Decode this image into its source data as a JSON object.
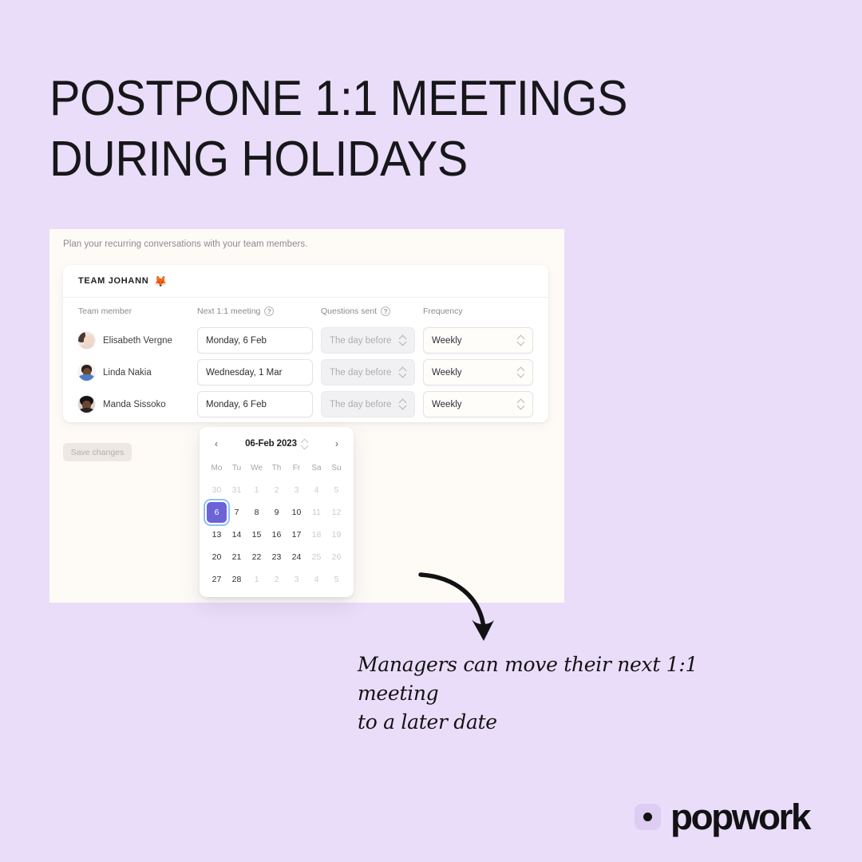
{
  "theme": {
    "page_bg": "#EADDFA",
    "panel_bg": "#FEFBF7",
    "accent_purple": "#6C63D8",
    "focus_ring": "#8DC3F0",
    "text_dark": "#17171A"
  },
  "headline": {
    "line1": "Postpone 1:1 meetings",
    "line2": "during holidays"
  },
  "panel": {
    "subtitle": "Plan your recurring conversations with your team members.",
    "team": {
      "name": "Team Johann",
      "emoji": "🦊"
    },
    "columns": {
      "member": "Team member",
      "next_meeting": "Next 1:1 meeting",
      "questions_sent": "Questions sent",
      "frequency": "Frequency",
      "help_glyph": "?"
    },
    "rows": [
      {
        "name": "Elisabeth Vergne",
        "avatar": "avatar-elisabeth-vergne",
        "next_meeting": "Monday, 6 Feb",
        "questions_sent": "The day before",
        "frequency": "Weekly"
      },
      {
        "name": "Linda Nakia",
        "avatar": "avatar-linda-nakia",
        "next_meeting": "Wednesday, 1 Mar",
        "questions_sent": "The day before",
        "frequency": "Weekly"
      },
      {
        "name": "Manda Sissoko",
        "avatar": "avatar-manda-sissoko",
        "next_meeting": "Monday, 6 Feb",
        "questions_sent": "The day before",
        "frequency": "Weekly"
      }
    ],
    "save_button": "Save changes"
  },
  "calendar": {
    "title": "06-Feb 2023",
    "prev_glyph": "‹",
    "next_glyph": "›",
    "weekdays": [
      "Mo",
      "Tu",
      "We",
      "Th",
      "Fr",
      "Sa",
      "Su"
    ],
    "selected_day": "6",
    "weeks": [
      [
        {
          "d": "30",
          "muted": true
        },
        {
          "d": "31",
          "muted": true
        },
        {
          "d": "1",
          "muted": true
        },
        {
          "d": "2",
          "muted": true
        },
        {
          "d": "3",
          "muted": true
        },
        {
          "d": "4",
          "muted": true
        },
        {
          "d": "5",
          "muted": true
        }
      ],
      [
        {
          "d": "6",
          "muted": false,
          "selected": true
        },
        {
          "d": "7",
          "muted": false
        },
        {
          "d": "8",
          "muted": false
        },
        {
          "d": "9",
          "muted": false
        },
        {
          "d": "10",
          "muted": false
        },
        {
          "d": "11",
          "muted": true
        },
        {
          "d": "12",
          "muted": true
        }
      ],
      [
        {
          "d": "13",
          "muted": false
        },
        {
          "d": "14",
          "muted": false
        },
        {
          "d": "15",
          "muted": false
        },
        {
          "d": "16",
          "muted": false
        },
        {
          "d": "17",
          "muted": false
        },
        {
          "d": "18",
          "muted": true
        },
        {
          "d": "19",
          "muted": true
        }
      ],
      [
        {
          "d": "20",
          "muted": false
        },
        {
          "d": "21",
          "muted": false
        },
        {
          "d": "22",
          "muted": false
        },
        {
          "d": "23",
          "muted": false
        },
        {
          "d": "24",
          "muted": false
        },
        {
          "d": "25",
          "muted": true
        },
        {
          "d": "26",
          "muted": true
        }
      ],
      [
        {
          "d": "27",
          "muted": false
        },
        {
          "d": "28",
          "muted": false
        },
        {
          "d": "1",
          "muted": true
        },
        {
          "d": "2",
          "muted": true
        },
        {
          "d": "3",
          "muted": true
        },
        {
          "d": "4",
          "muted": true
        },
        {
          "d": "5",
          "muted": true
        }
      ]
    ]
  },
  "annotation": {
    "line1": "Managers can move their next 1:1 meeting",
    "line2": "to a later date"
  },
  "logo": {
    "text": "popwork"
  }
}
